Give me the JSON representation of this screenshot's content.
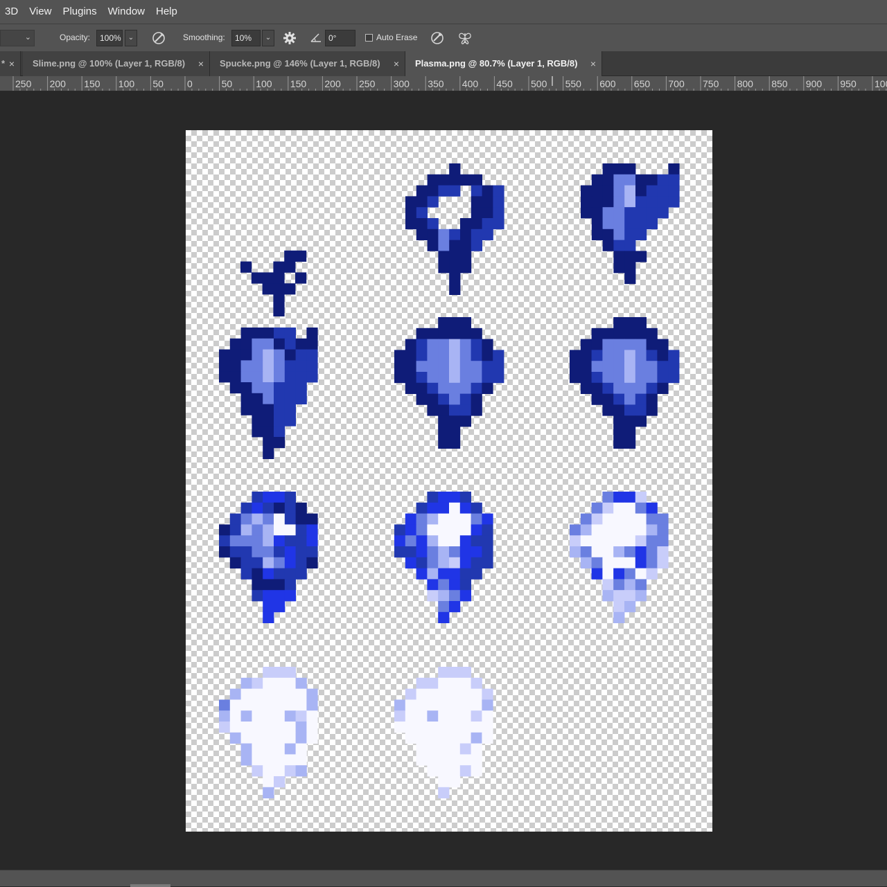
{
  "menu": {
    "items": [
      "3D",
      "View",
      "Plugins",
      "Window",
      "Help"
    ]
  },
  "options": {
    "opacity_label": "Opacity:",
    "opacity_value": "100%",
    "smoothing_label": "Smoothing:",
    "smoothing_value": "10%",
    "angle_value": "0°",
    "auto_erase_label": "Auto Erase",
    "auto_erase_checked": false
  },
  "tabs": [
    {
      "label": "*",
      "active": false
    },
    {
      "label": "Slime.png @ 100% (Layer 1, RGB/8)",
      "active": false
    },
    {
      "label": "Spucke.png @ 146% (Layer 1, RGB/8)",
      "active": false
    },
    {
      "label": "Plasma.png @ 80.7% (Layer 1, RGB/8)",
      "active": true
    }
  ],
  "ruler": {
    "labels": [
      "250",
      "200",
      "150",
      "100",
      "50",
      "0",
      "50",
      "100",
      "150",
      "200",
      "250",
      "300",
      "350",
      "400",
      "450",
      "500",
      "550",
      "600",
      "650",
      "700",
      "750",
      "800",
      "850",
      "900",
      "950",
      "100"
    ]
  },
  "document": {
    "name": "Plasma.png",
    "frame_count": 11,
    "palette": {
      "darkest": "#0f1c78",
      "dark": "#2138b0",
      "mid": "#6a7fe0",
      "light": "#a8b4f4",
      "bright": "#2035e6",
      "pale": "#c8cdfa",
      "white": "#f8f8ff"
    }
  },
  "icons": {
    "brush_angle": "brush-angle-icon",
    "settings": "gear-icon",
    "angle": "angle-icon",
    "pressure": "pressure-icon",
    "symmetry": "butterfly-symmetry-icon"
  }
}
